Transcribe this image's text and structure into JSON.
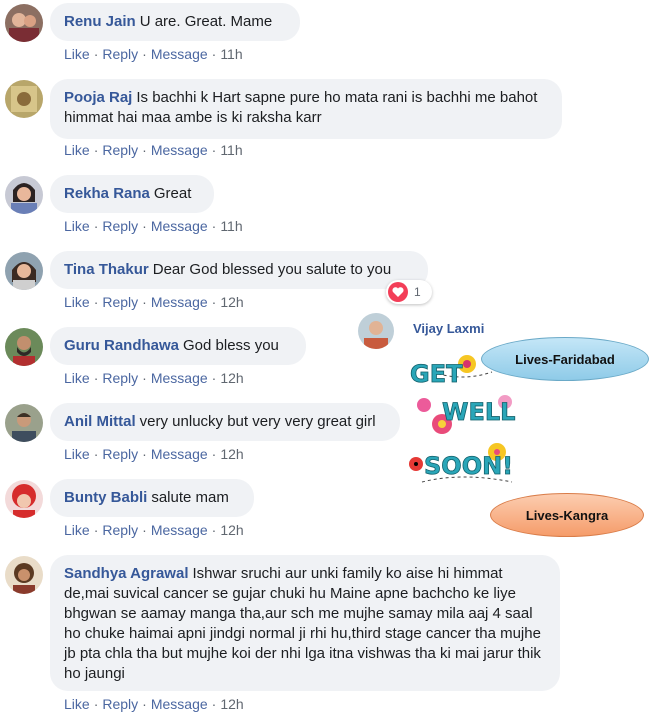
{
  "comments": [
    {
      "name": "Renu Jain",
      "text": "U are. Great. Mame",
      "time": "11h"
    },
    {
      "name": "Pooja Raj",
      "text": "Is bachhi k Hart sapne pure ho mata rani is bachhi me bahot himmat hai maa ambe is ki raksha karr",
      "time": "11h"
    },
    {
      "name": "Rekha Rana",
      "text": "Great",
      "time": "11h"
    },
    {
      "name": "Tina Thakur",
      "text": "Dear God blessed you salute to you",
      "time": "12h"
    },
    {
      "name": "Guru Randhawa",
      "text": "God bless you",
      "time": "12h"
    },
    {
      "name": "Anil Mittal",
      "text": "very unlucky but very very great girl",
      "time": "12h"
    },
    {
      "name": "Bunty Babli",
      "text": "salute mam",
      "time": "12h"
    },
    {
      "name": "Sandhya Agrawal",
      "text": "Ishwar sruchi aur unki family ko aise hi himmat de,mai suvical cancer se gujar chuki hu Maine apne bachcho ke liye bhgwan se aamay manga tha,aur sch me mujhe samay mila aaj 4 saal ho chuke haimai apni jindgi normal ji rhi hu,third stage cancer tha mujhe jb pta chla tha but mujhe koi der nhi lga itna vishwas tha ki mai jarur thik ho jaungi",
      "time": "12h"
    }
  ],
  "actions": {
    "like": "Like",
    "reply": "Reply",
    "message": "Message",
    "separator": "·"
  },
  "reaction": {
    "count": "1"
  },
  "sticker_post": {
    "author": "Vijay Laxmi",
    "sticker_text": "GET WELL SOON!"
  },
  "labels": {
    "top": "Lives-Faridabad",
    "bottom": "Lives-Kangra"
  },
  "colors": {
    "name_link": "#365899",
    "bubble_bg": "#f0f2f5",
    "meta_gray": "#606770",
    "label_blue": "#a9d7ef",
    "label_orange": "#f7b48a"
  }
}
